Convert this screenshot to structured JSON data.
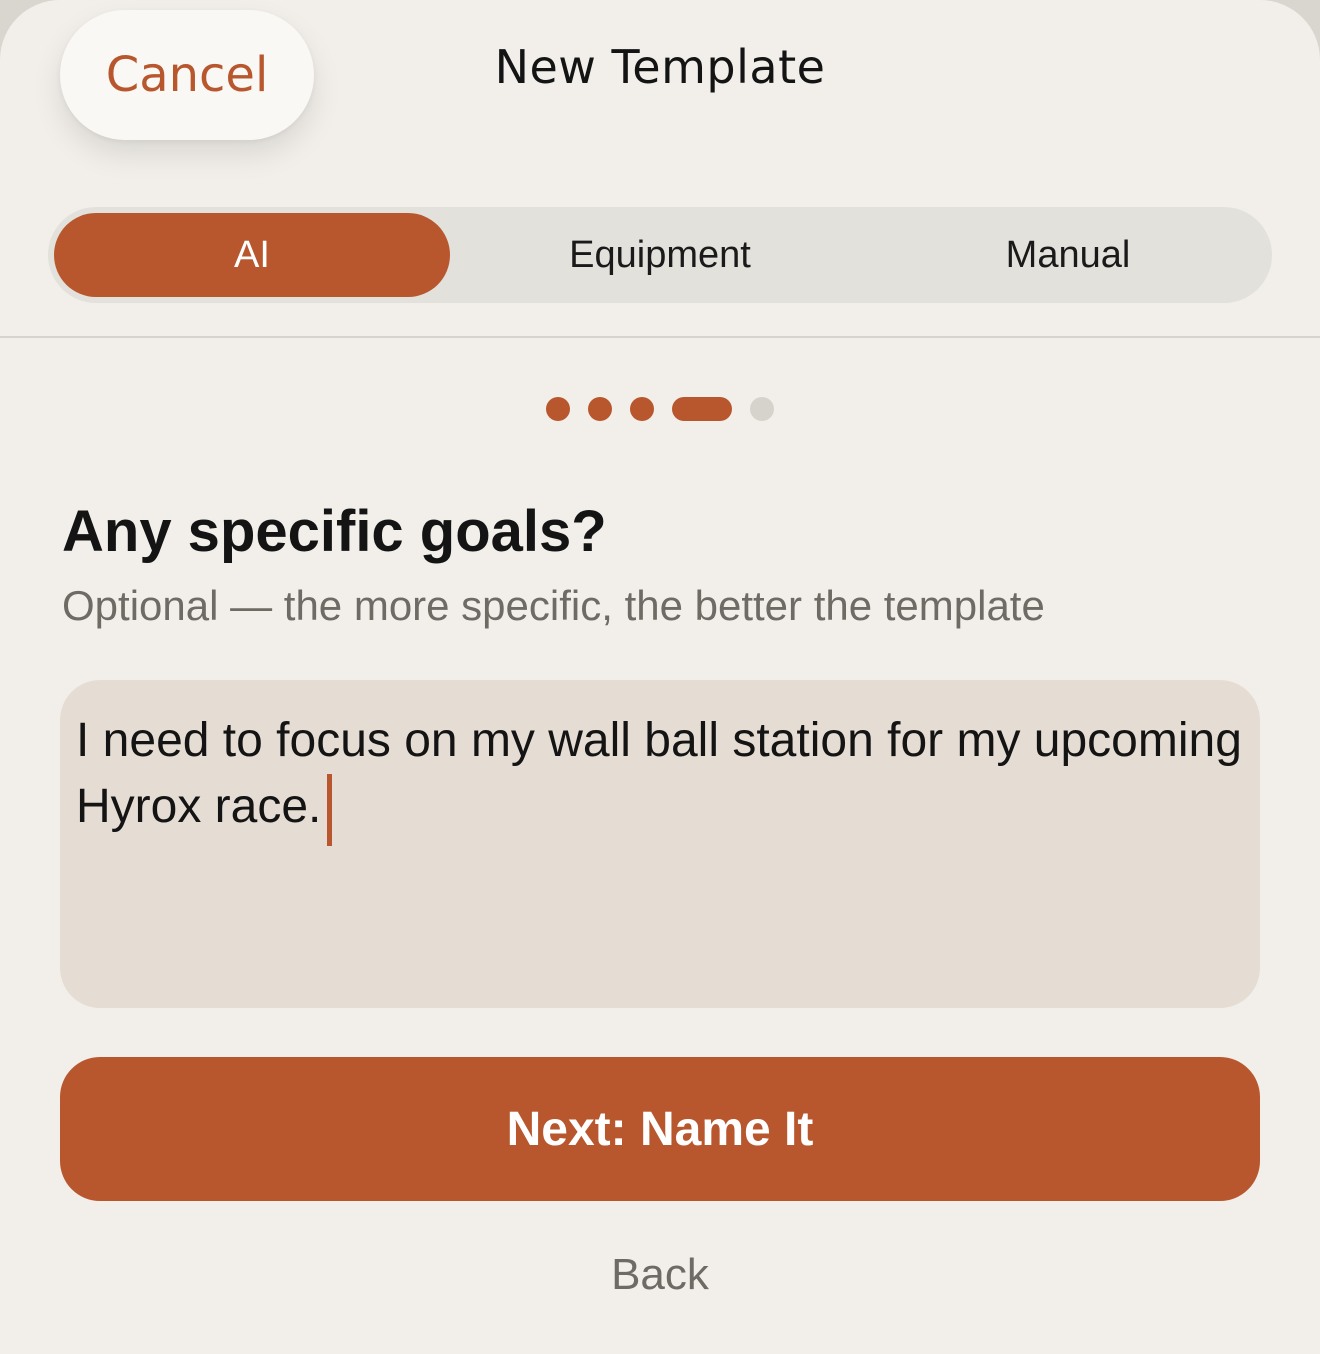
{
  "header": {
    "cancel_label": "Cancel",
    "title": "New Template"
  },
  "mode_tabs": [
    {
      "label": "AI",
      "selected": true
    },
    {
      "label": "Equipment",
      "selected": false
    },
    {
      "label": "Manual",
      "selected": false
    }
  ],
  "progress": {
    "total_steps": 5,
    "current_step": 4
  },
  "question": {
    "heading": "Any specific goals?",
    "subtext": "Optional — the more specific, the better the template"
  },
  "goals_input": {
    "value": "I need to focus on my wall ball station for my upcoming Hyrox race."
  },
  "actions": {
    "next_label": "Next: Name It",
    "back_label": "Back"
  },
  "colors": {
    "accent": "#b8572d",
    "background": "#f2efea",
    "input_background": "#e5ddd4",
    "segment_track": "#e3e1dc",
    "muted_text": "#6e6a64"
  }
}
